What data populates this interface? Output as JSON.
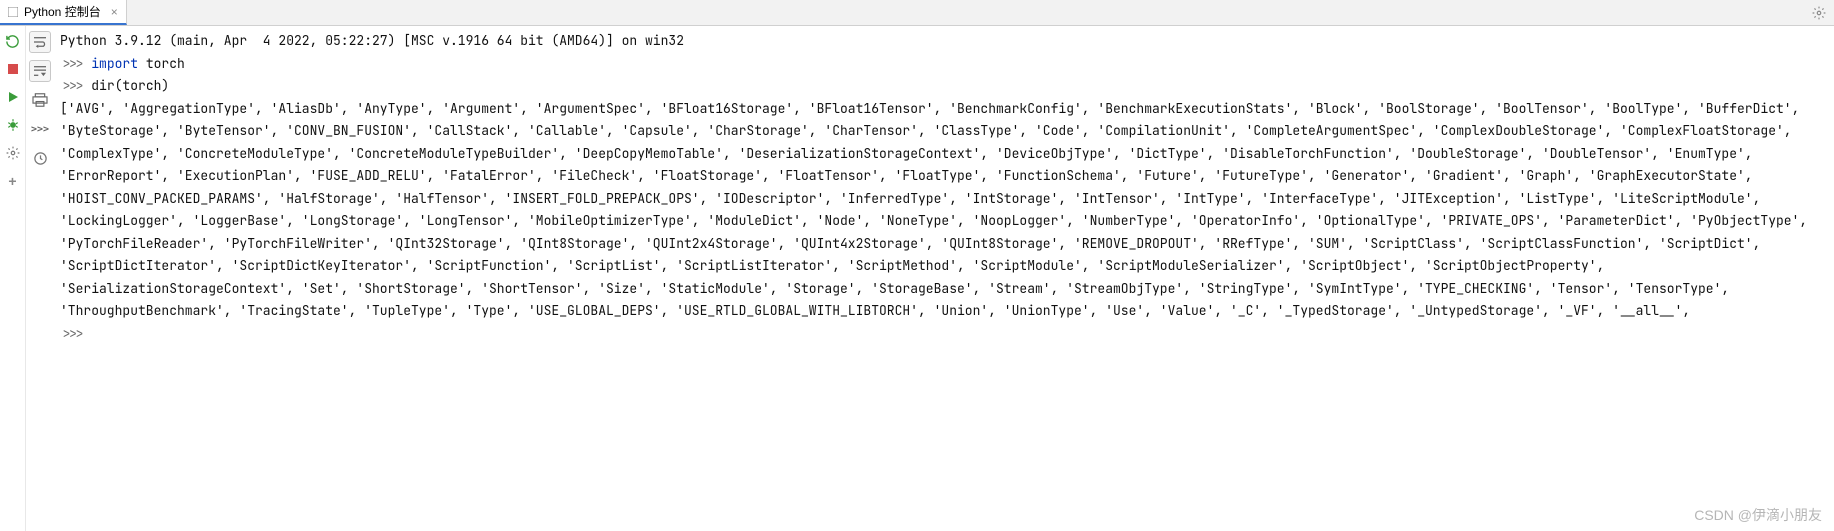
{
  "tab": {
    "title": "Python 控制台",
    "close": "×"
  },
  "console": {
    "banner": "Python 3.9.12 (main, Apr  4 2022, 05:22:27) [MSC v.1916 64 bit (AMD64)] on win32",
    "prompt": ">>>",
    "line1_kw": "import",
    "line1_rest": " torch",
    "line2": "dir(torch)",
    "output": "['AVG', 'AggregationType', 'AliasDb', 'AnyType', 'Argument', 'ArgumentSpec', 'BFloat16Storage', 'BFloat16Tensor', 'BenchmarkConfig', 'BenchmarkExecutionStats', 'Block', 'BoolStorage', 'BoolTensor', 'BoolType', 'BufferDict', 'ByteStorage', 'ByteTensor', 'CONV_BN_FUSION', 'CallStack', 'Callable', 'Capsule', 'CharStorage', 'CharTensor', 'ClassType', 'Code', 'CompilationUnit', 'CompleteArgumentSpec', 'ComplexDoubleStorage', 'ComplexFloatStorage', 'ComplexType', 'ConcreteModuleType', 'ConcreteModuleTypeBuilder', 'DeepCopyMemoTable', 'DeserializationStorageContext', 'DeviceObjType', 'DictType', 'DisableTorchFunction', 'DoubleStorage', 'DoubleTensor', 'EnumType', 'ErrorReport', 'ExecutionPlan', 'FUSE_ADD_RELU', 'FatalError', 'FileCheck', 'FloatStorage', 'FloatTensor', 'FloatType', 'FunctionSchema', 'Future', 'FutureType', 'Generator', 'Gradient', 'Graph', 'GraphExecutorState', 'HOIST_CONV_PACKED_PARAMS', 'HalfStorage', 'HalfTensor', 'INSERT_FOLD_PREPACK_OPS', 'IODescriptor', 'InferredType', 'IntStorage', 'IntTensor', 'IntType', 'InterfaceType', 'JITException', 'ListType', 'LiteScriptModule', 'LockingLogger', 'LoggerBase', 'LongStorage', 'LongTensor', 'MobileOptimizerType', 'ModuleDict', 'Node', 'NoneType', 'NoopLogger', 'NumberType', 'OperatorInfo', 'OptionalType', 'PRIVATE_OPS', 'ParameterDict', 'PyObjectType', 'PyTorchFileReader', 'PyTorchFileWriter', 'QInt32Storage', 'QInt8Storage', 'QUInt2x4Storage', 'QUInt4x2Storage', 'QUInt8Storage', 'REMOVE_DROPOUT', 'RRefType', 'SUM', 'ScriptClass', 'ScriptClassFunction', 'ScriptDict', 'ScriptDictIterator', 'ScriptDictKeyIterator', 'ScriptFunction', 'ScriptList', 'ScriptListIterator', 'ScriptMethod', 'ScriptModule', 'ScriptModuleSerializer', 'ScriptObject', 'ScriptObjectProperty', 'SerializationStorageContext', 'Set', 'ShortStorage', 'ShortTensor', 'Size', 'StaticModule', 'Storage', 'StorageBase', 'Stream', 'StreamObjType', 'StringType', 'SymIntType', 'TYPE_CHECKING', 'Tensor', 'TensorType', 'ThroughputBenchmark', 'TracingState', 'TupleType', 'Type', 'USE_GLOBAL_DEPS', 'USE_RTLD_GLOBAL_WITH_LIBTORCH', 'Union', 'UnionType', 'Use', 'Value', '_C', '_TypedStorage', '_UntypedStorage', '_VF', '__all__',"
  },
  "watermark": "CSDN @伊滴小朋友",
  "icons": {
    "gear": "gear",
    "rerun": "rerun",
    "stop": "stop",
    "run": "run",
    "debug": "debug",
    "settings": "settings",
    "add": "add",
    "newline": "newline",
    "printer": "printer",
    "prompt_toggle": ">>>",
    "history": "history"
  }
}
